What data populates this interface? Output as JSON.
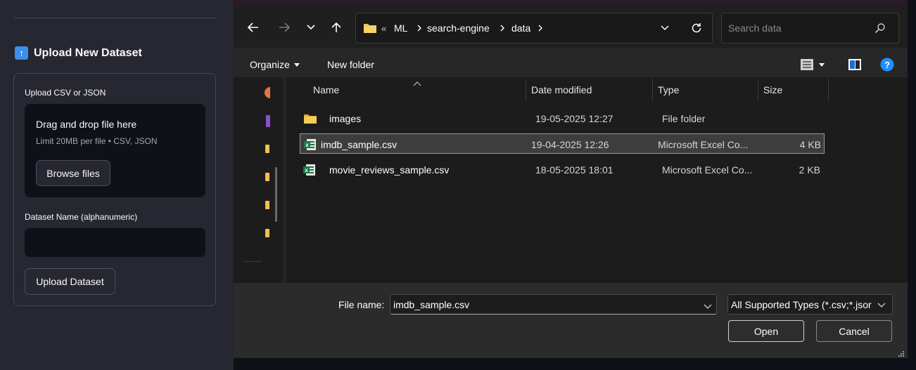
{
  "sidebar": {
    "heading": "Upload New Dataset",
    "uploader_label": "Upload CSV or JSON",
    "dropzone_title": "Drag and drop file here",
    "dropzone_limit": "Limit 20MB per file • CSV, JSON",
    "browse_label": "Browse files",
    "dataset_name_label": "Dataset Name (alphanumeric)",
    "dataset_name_value": "",
    "upload_label": "Upload Dataset"
  },
  "dialog": {
    "breadcrumb": [
      "ML",
      "search-engine",
      "data"
    ],
    "breadcrumb_overflow": "«",
    "search_placeholder": "Search data",
    "organize_label": "Organize",
    "new_folder_label": "New folder",
    "columns": {
      "name": "Name",
      "date": "Date modified",
      "type": "Type",
      "size": "Size"
    },
    "files": [
      {
        "name": "images",
        "date": "19-05-2025 12:27",
        "type": "File folder",
        "size": "",
        "icon": "folder-icon",
        "selected": false
      },
      {
        "name": "imdb_sample.csv",
        "date": "19-04-2025 12:26",
        "type": "Microsoft Excel Co...",
        "size": "4 KB",
        "icon": "excel-csv-icon",
        "selected": true
      },
      {
        "name": "movie_reviews_sample.csv",
        "date": "18-05-2025 18:01",
        "type": "Microsoft Excel Co...",
        "size": "2 KB",
        "icon": "excel-csv-icon",
        "selected": false
      }
    ],
    "file_name_label": "File name:",
    "file_name_value": "imdb_sample.csv",
    "file_type_value": "All Supported Types (*.csv;*.jsor",
    "open_label": "Open",
    "cancel_label": "Cancel"
  },
  "colors": {
    "sidebar_bg": "#262730",
    "app_bg": "#0e1117",
    "dialog_bg": "#202020",
    "folder": "#f2c14e",
    "excel_green": "#1d7a45",
    "help_blue": "#1e90ff"
  }
}
